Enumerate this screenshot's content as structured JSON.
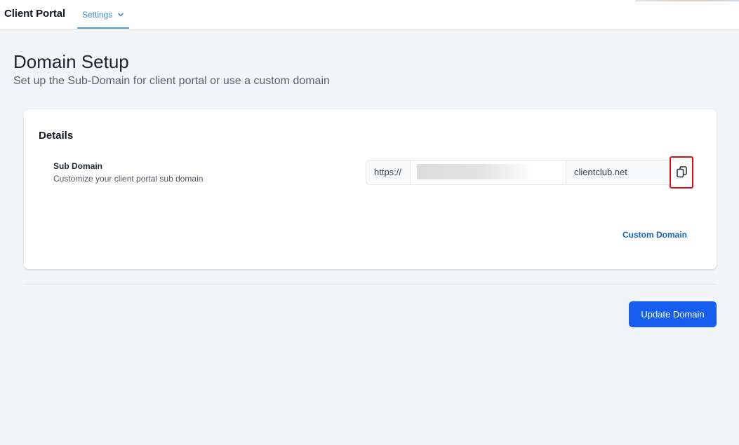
{
  "header": {
    "app_title": "Client Portal",
    "nav_tab_label": "Settings"
  },
  "page": {
    "title": "Domain Setup",
    "subtitle": "Set up the Sub-Domain for client portal or use a custom domain"
  },
  "card": {
    "heading": "Details",
    "sub_domain": {
      "label": "Sub Domain",
      "help": "Customize your client portal sub domain",
      "prefix": "https://",
      "value": "",
      "suffix": "clientclub.net"
    },
    "custom_domain_link": "Custom Domain"
  },
  "actions": {
    "update_label": "Update Domain"
  },
  "icons": {
    "nav_chevron": "chevron-down-icon",
    "copy": "copy-icon"
  },
  "colors": {
    "primary": "#155eef",
    "link": "#1565c0",
    "nav_active": "#3b8ed3",
    "highlight_border": "#e30b16",
    "background": "#f1f5f8"
  }
}
